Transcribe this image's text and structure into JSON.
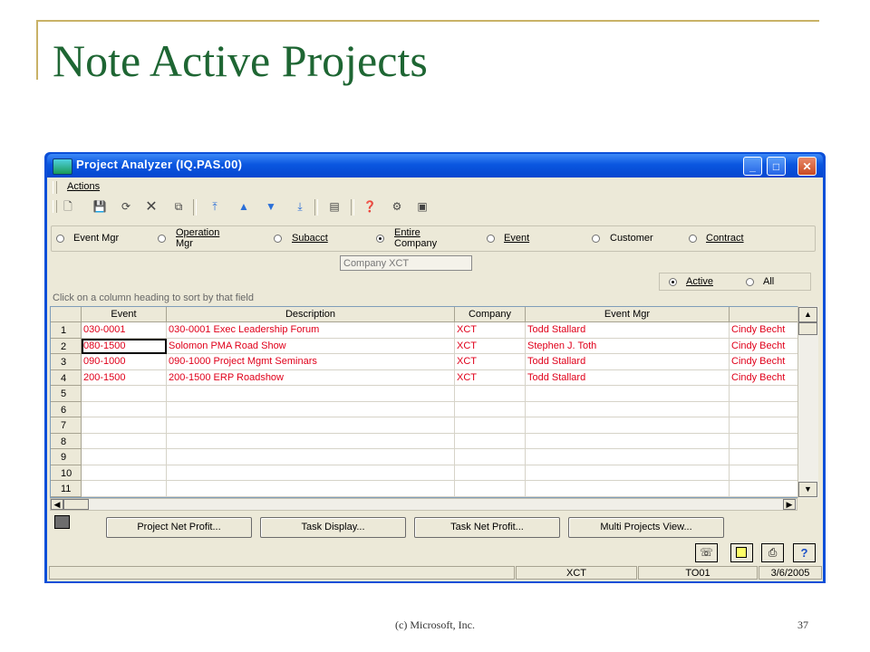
{
  "slide": {
    "title": "Note Active Projects",
    "footer": "(c) Microsoft, Inc.",
    "page_number": "37"
  },
  "window": {
    "title": "Project Analyzer (IQ.PAS.00)",
    "menu": [
      "Actions"
    ]
  },
  "filters": {
    "event_mgr": "Event Mgr",
    "operation_mgr_l1": "Operation",
    "operation_mgr_l2": "Mgr",
    "subacct": "Subacct",
    "entire_company_l1": "Entire",
    "entire_company_l2": "Company",
    "event": "Event",
    "customer": "Customer",
    "contract": "Contract",
    "selected": "Entire Company"
  },
  "company_field": {
    "value": "Company XCT"
  },
  "status_filter": {
    "active": "Active",
    "all": "All",
    "selected": "Active"
  },
  "hint": "Click on a column heading to sort by that field",
  "grid": {
    "columns": [
      "Event",
      "Description",
      "Company",
      "Event Mgr",
      ""
    ],
    "rows": [
      {
        "num": "1",
        "event": "030-0001",
        "description": "030-0001 Exec Leadership Forum",
        "company": "XCT",
        "event_mgr": "Todd Stallard",
        "extra": "Cindy Becht"
      },
      {
        "num": "2",
        "event": "080-1500",
        "description": "Solomon PMA Road Show",
        "company": "XCT",
        "event_mgr": "Stephen J. Toth",
        "extra": "Cindy Becht"
      },
      {
        "num": "3",
        "event": "090-1000",
        "description": "090-1000 Project Mgmt Seminars",
        "company": "XCT",
        "event_mgr": "Todd Stallard",
        "extra": "Cindy Becht"
      },
      {
        "num": "4",
        "event": "200-1500",
        "description": "200-1500 ERP Roadshow",
        "company": "XCT",
        "event_mgr": "Todd Stallard",
        "extra": "Cindy Becht"
      },
      {
        "num": "5",
        "event": "",
        "description": "",
        "company": "",
        "event_mgr": "",
        "extra": ""
      },
      {
        "num": "6",
        "event": "",
        "description": "",
        "company": "",
        "event_mgr": "",
        "extra": ""
      },
      {
        "num": "7",
        "event": "",
        "description": "",
        "company": "",
        "event_mgr": "",
        "extra": ""
      },
      {
        "num": "8",
        "event": "",
        "description": "",
        "company": "",
        "event_mgr": "",
        "extra": ""
      },
      {
        "num": "9",
        "event": "",
        "description": "",
        "company": "",
        "event_mgr": "",
        "extra": ""
      },
      {
        "num": "10",
        "event": "",
        "description": "",
        "company": "",
        "event_mgr": "",
        "extra": ""
      },
      {
        "num": "11",
        "event": "",
        "description": "",
        "company": "",
        "event_mgr": "",
        "extra": ""
      }
    ]
  },
  "buttons": {
    "project_net_profit": "Project Net Profit...",
    "task_display": "Task Display...",
    "task_net_profit": "Task Net Profit...",
    "multi_projects_view": "Multi Projects View..."
  },
  "status_bar": {
    "company": "XCT",
    "user": "TO01",
    "date": "3/6/2005"
  },
  "colors": {
    "title_green": "#1e6633",
    "row_text_red": "#e0001a",
    "titlebar_blue": "#0a56e0"
  }
}
